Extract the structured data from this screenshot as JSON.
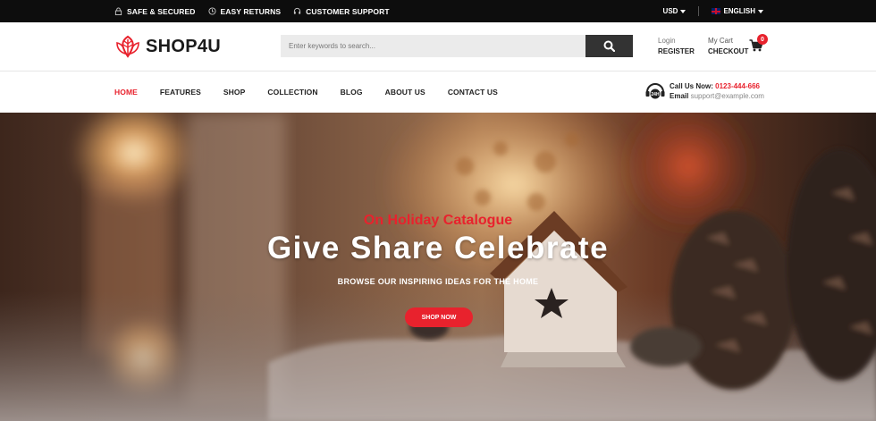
{
  "topbar": {
    "features": [
      {
        "label": "SAFE & SECURED",
        "icon": "lock-icon"
      },
      {
        "label": "EASY RETURNS",
        "icon": "return-icon"
      },
      {
        "label": "CUSTOMER SUPPORT",
        "icon": "headset-icon"
      }
    ],
    "currency": "USD",
    "language": "ENGLISH"
  },
  "header": {
    "logo_text": "SHOP4U",
    "search_placeholder": "Enter keywords to search...",
    "login_label": "Login",
    "register_label": "REGISTER",
    "cart_label": "My Cart",
    "checkout_label": "CHECKOUT",
    "cart_count": "0"
  },
  "nav": {
    "items": [
      "HOME",
      "FEATURES",
      "SHOP",
      "COLLECTION",
      "BLOG",
      "ABOUT US",
      "CONTACT US"
    ],
    "active_index": 0,
    "call_label": "Call Us Now:",
    "phone": "0123-444-666",
    "email_label": "Email",
    "email": "support@example.com",
    "badge_text": "24H"
  },
  "hero": {
    "subtitle": "On Holiday Catalogue",
    "title": "Give Share Celebrate",
    "description": "BROWSE OUR INSPIRING IDEAS FOR THE HOME",
    "button_label": "SHOP NOW"
  },
  "colors": {
    "accent": "#e8222d",
    "topbar_bg": "#0d0d0d",
    "search_button": "#333333"
  }
}
